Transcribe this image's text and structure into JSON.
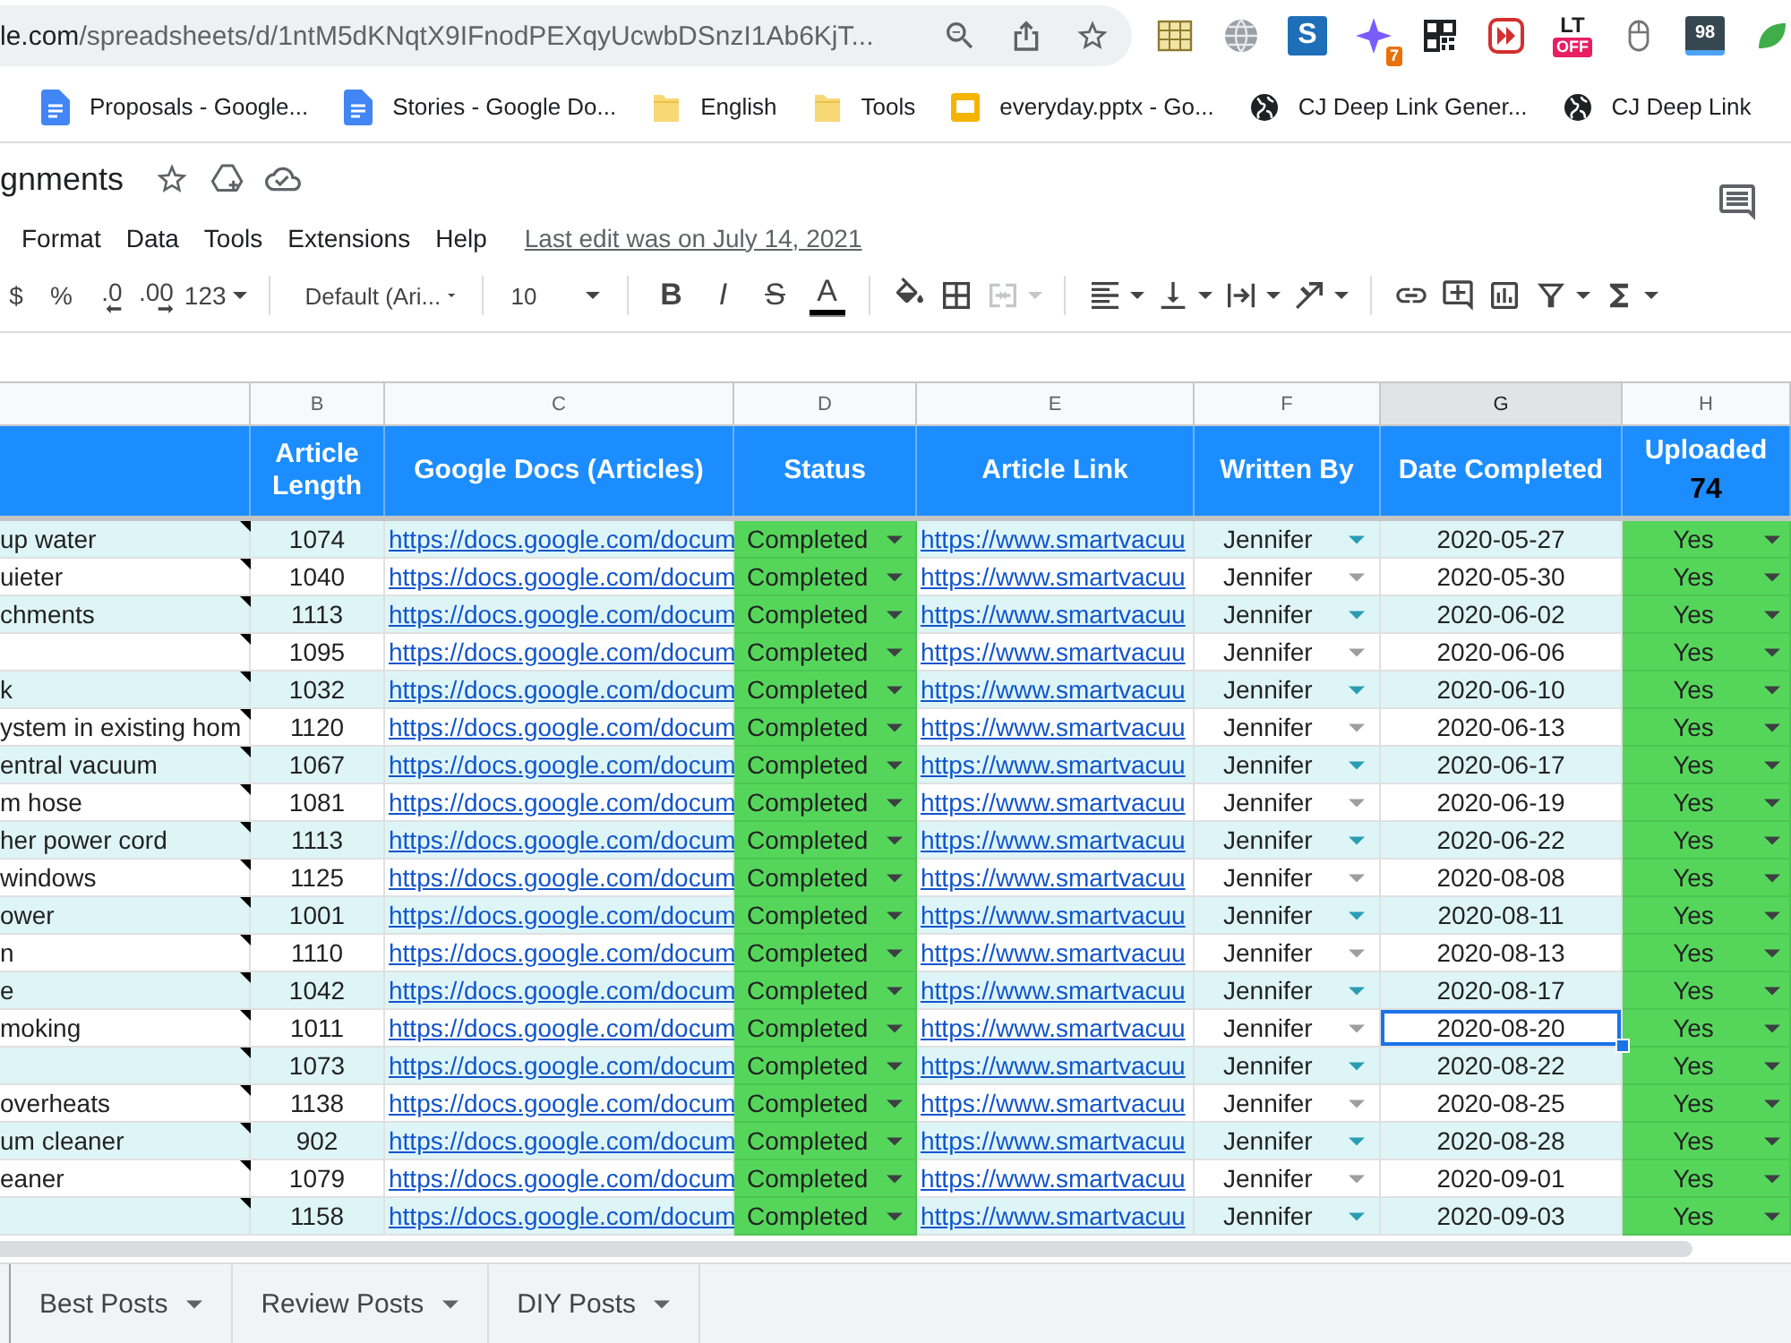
{
  "browser": {
    "url_host": "le.com",
    "url_path": "/spreadsheets/d/1ntM5dKNqtX9IFnodPEXqyUcwbDSnzI1Ab6KjT...",
    "extensions": [
      {
        "kind": "sheet"
      },
      {
        "kind": "globe"
      },
      {
        "kind": "letter",
        "label": "S"
      },
      {
        "kind": "sparkle",
        "badge": "7"
      },
      {
        "kind": "qr"
      },
      {
        "kind": "forward"
      },
      {
        "kind": "label",
        "label": "LT",
        "badge": "OFF"
      },
      {
        "kind": "mouse"
      },
      {
        "kind": "counter",
        "label": "98"
      },
      {
        "kind": "leaf"
      }
    ],
    "bookmarks": [
      {
        "kind": "doc",
        "label": "Proposals - Google..."
      },
      {
        "kind": "doc",
        "label": "Stories - Google Do..."
      },
      {
        "kind": "folder",
        "label": "English"
      },
      {
        "kind": "folder",
        "label": "Tools"
      },
      {
        "kind": "slides",
        "label": "everyday.pptx - Go..."
      },
      {
        "kind": "globe",
        "label": "CJ Deep Link Gener..."
      },
      {
        "kind": "globe",
        "label": "CJ Deep Link"
      }
    ]
  },
  "sheet": {
    "title": "gnments",
    "menu": [
      "Format",
      "Data",
      "Tools",
      "Extensions",
      "Help"
    ],
    "last_edit": "Last edit was on July 14, 2021"
  },
  "toolbar": [
    [
      {
        "kind": "text",
        "label": "$",
        "menu": false,
        "disabled": false
      },
      {
        "kind": "text",
        "label": "%",
        "menu": false,
        "disabled": false
      },
      {
        "kind": "decimal-decrease",
        "label": ".0",
        "menu": false,
        "disabled": false
      },
      {
        "kind": "decimal-increase",
        "label": ".00",
        "menu": false,
        "disabled": false
      },
      {
        "kind": "format",
        "label": "123",
        "menu": true,
        "disabled": false
      }
    ],
    [
      {
        "kind": "font",
        "label": "Default (Ari...",
        "menu": true,
        "disabled": false
      }
    ],
    [
      {
        "kind": "size",
        "label": "10",
        "menu": true,
        "disabled": false
      }
    ],
    [
      {
        "kind": "bold",
        "label": "B",
        "menu": false,
        "disabled": false
      },
      {
        "kind": "italic",
        "label": "I",
        "menu": false,
        "disabled": false
      },
      {
        "kind": "strikethrough",
        "label": "S",
        "menu": false,
        "disabled": false
      },
      {
        "kind": "text-color",
        "label": "A",
        "menu": false,
        "disabled": false
      }
    ],
    [
      {
        "kind": "fill-color",
        "menu": false,
        "disabled": false
      },
      {
        "kind": "borders",
        "menu": false,
        "disabled": false
      },
      {
        "kind": "merge",
        "menu": true,
        "disabled": true
      }
    ],
    [
      {
        "kind": "align",
        "menu": true,
        "disabled": false
      },
      {
        "kind": "valign",
        "menu": true,
        "disabled": false
      },
      {
        "kind": "wrap",
        "menu": true,
        "disabled": false
      },
      {
        "kind": "rotate",
        "menu": true,
        "disabled": false
      }
    ],
    [
      {
        "kind": "link",
        "menu": false,
        "disabled": false
      },
      {
        "kind": "comment",
        "menu": false,
        "disabled": false
      },
      {
        "kind": "chart",
        "menu": false,
        "disabled": false
      },
      {
        "kind": "filter",
        "menu": true,
        "disabled": false
      },
      {
        "kind": "functions",
        "menu": true,
        "disabled": false
      }
    ]
  ],
  "table": {
    "columns": [
      {
        "letter": "B",
        "heading": "Article Length",
        "selected": false
      },
      {
        "letter": "C",
        "heading": "Google Docs (Articles)",
        "selected": false
      },
      {
        "letter": "D",
        "heading": "Status",
        "selected": false
      },
      {
        "letter": "E",
        "heading": "Article Link",
        "selected": false
      },
      {
        "letter": "F",
        "heading": "Written By",
        "selected": false
      },
      {
        "letter": "G",
        "heading": "Date Completed",
        "selected": true
      },
      {
        "letter": "H",
        "heading": "Uploaded",
        "count": "74",
        "selected": false
      }
    ],
    "rows": [
      {
        "column_a": "up water",
        "note": true,
        "article_length": "1074",
        "google_doc": "https://docs.google.com/docum",
        "status": "Completed",
        "article_link": "https://www.smartvacuu",
        "written_by": "Jennifer",
        "date_completed": "2020-05-27",
        "uploaded": "Yes",
        "selected": false
      },
      {
        "column_a": "uieter",
        "note": true,
        "article_length": "1040",
        "google_doc": "https://docs.google.com/docum",
        "status": "Completed",
        "article_link": "https://www.smartvacuu",
        "written_by": "Jennifer",
        "date_completed": "2020-05-30",
        "uploaded": "Yes",
        "selected": false
      },
      {
        "column_a": "chments",
        "note": true,
        "article_length": "1113",
        "google_doc": "https://docs.google.com/docum",
        "status": "Completed",
        "article_link": "https://www.smartvacuu",
        "written_by": "Jennifer",
        "date_completed": "2020-06-02",
        "uploaded": "Yes",
        "selected": false
      },
      {
        "note": true,
        "article_length": "1095",
        "google_doc": "https://docs.google.com/docum",
        "status": "Completed",
        "article_link": "https://www.smartvacuu",
        "written_by": "Jennifer",
        "date_completed": "2020-06-06",
        "uploaded": "Yes",
        "selected": false
      },
      {
        "column_a": "k",
        "note": true,
        "article_length": "1032",
        "google_doc": "https://docs.google.com/docum",
        "status": "Completed",
        "article_link": "https://www.smartvacuu",
        "written_by": "Jennifer",
        "date_completed": "2020-06-10",
        "uploaded": "Yes",
        "selected": false
      },
      {
        "column_a": "ystem in existing hom",
        "note": true,
        "article_length": "1120",
        "google_doc": "https://docs.google.com/docum",
        "status": "Completed",
        "article_link": "https://www.smartvacuu",
        "written_by": "Jennifer",
        "date_completed": "2020-06-13",
        "uploaded": "Yes",
        "selected": false
      },
      {
        "column_a": "entral vacuum",
        "note": true,
        "article_length": "1067",
        "google_doc": "https://docs.google.com/docum",
        "status": "Completed",
        "article_link": "https://www.smartvacuu",
        "written_by": "Jennifer",
        "date_completed": "2020-06-17",
        "uploaded": "Yes",
        "selected": false
      },
      {
        "column_a": "m hose",
        "note": true,
        "article_length": "1081",
        "google_doc": "https://docs.google.com/docum",
        "status": "Completed",
        "article_link": "https://www.smartvacuu",
        "written_by": "Jennifer",
        "date_completed": "2020-06-19",
        "uploaded": "Yes",
        "selected": false
      },
      {
        "column_a": "her power cord",
        "note": true,
        "article_length": "1113",
        "google_doc": "https://docs.google.com/docum",
        "status": "Completed",
        "article_link": "https://www.smartvacuu",
        "written_by": "Jennifer",
        "date_completed": "2020-06-22",
        "uploaded": "Yes",
        "selected": false
      },
      {
        "column_a": "windows",
        "note": true,
        "article_length": "1125",
        "google_doc": "https://docs.google.com/docum",
        "status": "Completed",
        "article_link": "https://www.smartvacuu",
        "written_by": "Jennifer",
        "date_completed": "2020-08-08",
        "uploaded": "Yes",
        "selected": false
      },
      {
        "column_a": "ower",
        "note": true,
        "article_length": "1001",
        "google_doc": "https://docs.google.com/docum",
        "status": "Completed",
        "article_link": "https://www.smartvacuu",
        "written_by": "Jennifer",
        "date_completed": "2020-08-11",
        "uploaded": "Yes",
        "selected": false
      },
      {
        "column_a": "n",
        "note": true,
        "article_length": "1110",
        "google_doc": "https://docs.google.com/docum",
        "status": "Completed",
        "article_link": "https://www.smartvacuu",
        "written_by": "Jennifer",
        "date_completed": "2020-08-13",
        "uploaded": "Yes",
        "selected": false
      },
      {
        "column_a": "e",
        "note": true,
        "article_length": "1042",
        "google_doc": "https://docs.google.com/docum",
        "status": "Completed",
        "article_link": "https://www.smartvacuu",
        "written_by": "Jennifer",
        "date_completed": "2020-08-17",
        "uploaded": "Yes",
        "selected": false
      },
      {
        "column_a": "moking",
        "note": true,
        "article_length": "1011",
        "google_doc": "https://docs.google.com/docum",
        "status": "Completed",
        "article_link": "https://www.smartvacuu",
        "written_by": "Jennifer",
        "date_completed": "2020-08-20",
        "uploaded": "Yes",
        "selected": true
      },
      {
        "note": true,
        "article_length": "1073",
        "google_doc": "https://docs.google.com/docum",
        "status": "Completed",
        "article_link": "https://www.smartvacuu",
        "written_by": "Jennifer",
        "date_completed": "2020-08-22",
        "uploaded": "Yes",
        "selected": false
      },
      {
        "column_a": "overheats",
        "note": true,
        "article_length": "1138",
        "google_doc": "https://docs.google.com/docum",
        "status": "Completed",
        "article_link": "https://www.smartvacuu",
        "written_by": "Jennifer",
        "date_completed": "2020-08-25",
        "uploaded": "Yes",
        "selected": false
      },
      {
        "column_a": "um cleaner",
        "note": true,
        "article_length": "902",
        "google_doc": "https://docs.google.com/docum",
        "status": "Completed",
        "article_link": "https://www.smartvacuu",
        "written_by": "Jennifer",
        "date_completed": "2020-08-28",
        "uploaded": "Yes",
        "selected": false
      },
      {
        "column_a": "eaner",
        "note": true,
        "article_length": "1079",
        "google_doc": "https://docs.google.com/docum",
        "status": "Completed",
        "article_link": "https://www.smartvacuu",
        "written_by": "Jennifer",
        "date_completed": "2020-09-01",
        "uploaded": "Yes",
        "selected": false
      },
      {
        "note": true,
        "article_length": "1158",
        "google_doc": "https://docs.google.com/docum",
        "status": "Completed",
        "article_link": "https://www.smartvacuu",
        "written_by": "Jennifer",
        "date_completed": "2020-09-03",
        "uploaded": "Yes",
        "selected": false
      }
    ]
  },
  "sheet_tabs": [
    "Best Posts",
    "Review Posts",
    "DIY Posts"
  ]
}
